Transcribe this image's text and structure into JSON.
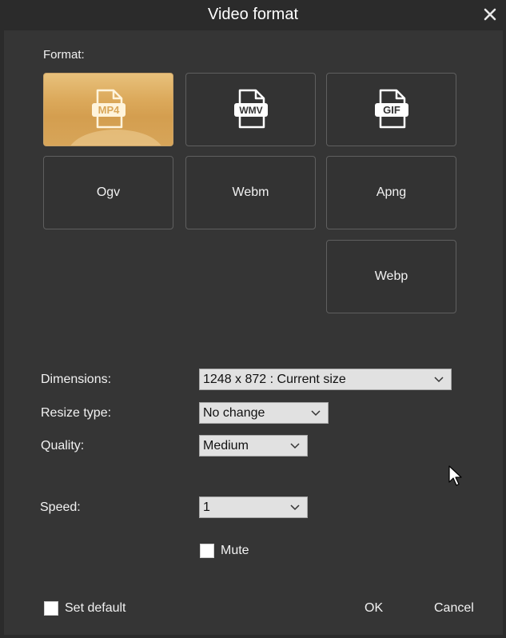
{
  "window": {
    "title": "Video format",
    "close_icon": "close-icon"
  },
  "format": {
    "label": "Format:",
    "options": [
      {
        "label": "MP4",
        "icon": "mp4-file-icon",
        "selected": true
      },
      {
        "label": "WMV",
        "icon": "wmv-file-icon",
        "selected": false
      },
      {
        "label": "GIF",
        "icon": "gif-file-icon",
        "selected": false
      },
      {
        "label": "Ogv",
        "selected": false
      },
      {
        "label": "Webm",
        "selected": false
      },
      {
        "label": "Apng",
        "selected": false
      },
      {
        "label": "Webp",
        "selected": false
      }
    ]
  },
  "settings": {
    "dimensions": {
      "label": "Dimensions:",
      "value": "1248 x 872 : Current size"
    },
    "resize_type": {
      "label": "Resize type:",
      "value": "No change"
    },
    "quality": {
      "label": "Quality:",
      "value": "Medium"
    },
    "speed": {
      "label": "Speed:",
      "value": "1"
    },
    "mute": {
      "label": "Mute",
      "checked": false
    }
  },
  "footer": {
    "set_default": {
      "label": "Set default",
      "checked": false
    },
    "ok_label": "OK",
    "cancel_label": "Cancel"
  },
  "colors": {
    "background": "#2b2b2b",
    "panel": "#353535",
    "selected_tile": "#dcaa5c",
    "tile_border": "#5f5f5f"
  }
}
